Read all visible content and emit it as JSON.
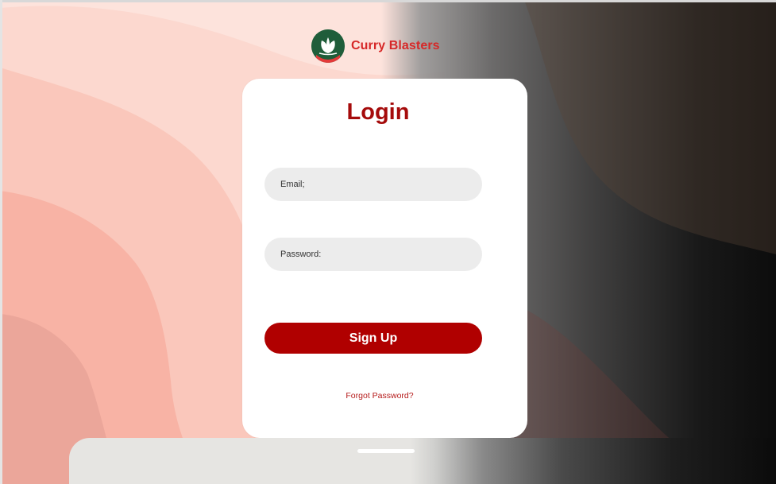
{
  "brand": {
    "name": "Curry Blasters",
    "logo_icon": "leaf-logo-icon",
    "color": "#d62828"
  },
  "login": {
    "title": "Login",
    "email_label": "Email;",
    "password_label": "Password:",
    "submit_label": "Sign Up",
    "forgot_label": "Forgot Password?"
  },
  "colors": {
    "accent": "#b00000",
    "title": "#a50b0b",
    "field_bg": "#ececec",
    "bg_pink": "#f9c1b4",
    "bg_dark": "#0e0e0e"
  }
}
